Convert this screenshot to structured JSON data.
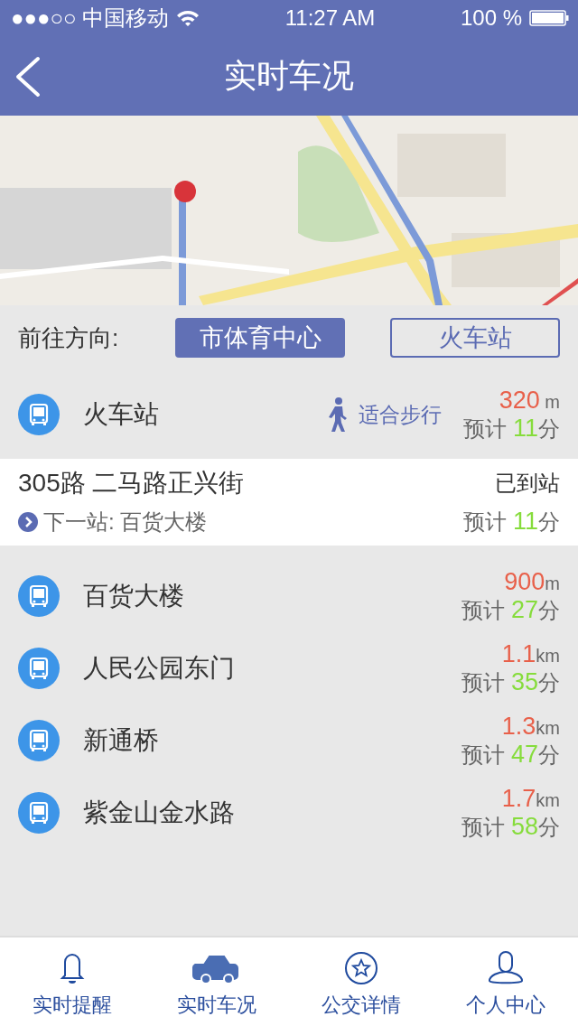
{
  "status_bar": {
    "carrier": "●●●○○ 中国移动",
    "time": "11:27 AM",
    "battery": "100 %"
  },
  "nav": {
    "title": "实时车况"
  },
  "direction": {
    "label": "前往方向:",
    "options": [
      {
        "label": "市体育中心",
        "selected": true
      },
      {
        "label": "火车站",
        "selected": false
      }
    ]
  },
  "nearest_stop": {
    "name": "火车站",
    "walk": "适合步行",
    "distance": "320",
    "unit": " m",
    "eta_prefix": "预计 ",
    "minutes": "11",
    "minute_unit": "分"
  },
  "bus": {
    "route": "305路 二马路正兴街",
    "status": "已到站",
    "next": "下一站: 百货大楼",
    "eta_prefix": "预计 ",
    "minutes": "11",
    "minute_unit": "分"
  },
  "stops": [
    {
      "name": "百货大楼",
      "distance": "900",
      "unit": "m",
      "eta_prefix": "预计 ",
      "minutes": "27",
      "minute_unit": "分"
    },
    {
      "name": "人民公园东门",
      "distance": "1.1",
      "unit": "km",
      "eta_prefix": "预计 ",
      "minutes": "35",
      "minute_unit": "分"
    },
    {
      "name": "新通桥",
      "distance": "1.3",
      "unit": "km",
      "eta_prefix": "预计 ",
      "minutes": "47",
      "minute_unit": "分"
    },
    {
      "name": "紫金山金水路",
      "distance": "1.7",
      "unit": "km",
      "eta_prefix": "预计 ",
      "minutes": "58",
      "minute_unit": "分"
    }
  ],
  "tabs": [
    {
      "label": "实时提醒",
      "kind": "bell",
      "selected": false
    },
    {
      "label": "实时车况",
      "kind": "car",
      "selected": true
    },
    {
      "label": "公交详情",
      "kind": "star",
      "selected": false
    },
    {
      "label": "个人中心",
      "kind": "person",
      "selected": false
    }
  ]
}
